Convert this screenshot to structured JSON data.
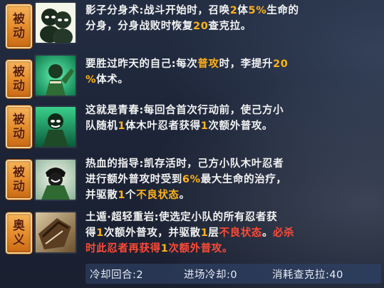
{
  "skills": [
    {
      "badge": [
        "被",
        "动"
      ],
      "icon": "shadow-clone-icon",
      "line1_a": "影子分身术:战斗开始时，召唤",
      "line1_n1": "2",
      "line1_b": "体",
      "line1_n2": "5%",
      "line1_c": "生命的",
      "line2_a": "分身，分身战败时恢复",
      "line2_n": "20",
      "line2_b": "查克拉。"
    },
    {
      "badge": [
        "被",
        "动"
      ],
      "icon": "surpass-self-icon",
      "line1_a": "要胜过昨天的自己:每次",
      "line1_hl": "普攻",
      "line1_b": "时，李提升",
      "line1_n": "20",
      "line2_n": "%",
      "line2_b": "体术。"
    },
    {
      "badge": [
        "被",
        "动"
      ],
      "icon": "youth-icon",
      "line1": "这就是青春:每回合首次行动前，使己方小",
      "line2_a": "队随机",
      "line2_n1": "1",
      "line2_b": "体木叶忍者获得",
      "line2_n2": "1",
      "line2_c": "次额外普攻。"
    },
    {
      "badge": [
        "被",
        "动"
      ],
      "icon": "guidance-icon",
      "line1": "热血的指导:凯存活时，己方小队木叶忍者",
      "line2_a": "进行额外普攻时受到",
      "line2_n": "6%",
      "line2_b": "最大生命的治疗，",
      "line3_a": "并驱散",
      "line3_n": "1",
      "line3_b": "个",
      "line3_hl": "不良状态",
      "line3_c": "。"
    },
    {
      "badge": [
        "奥",
        "义"
      ],
      "icon": "rock-boulder-icon",
      "line1": "土遁·超轻重岩:使选定小队的所有忍者获",
      "line2_a": "得",
      "line2_n1": "1",
      "line2_b": "次额外普攻，并驱散",
      "line2_n2": "1",
      "line2_c": "层",
      "line2_hl": "不良状态",
      "line2_d": "。",
      "line2_red": "必杀",
      "line3_red_a": "时此忍者再获得",
      "line3_red_n": "1",
      "line3_red_b": "次额外普攻。"
    }
  ],
  "footer": {
    "cooldown": "冷却回合:2",
    "entry_cooldown": "进场冷却:0",
    "chakra_cost": "消耗查克拉:40"
  },
  "colors": {
    "highlight": "#ffb21a",
    "red": "#ff4a36",
    "text": "#f2f2f2",
    "badge": "#e48a28"
  }
}
